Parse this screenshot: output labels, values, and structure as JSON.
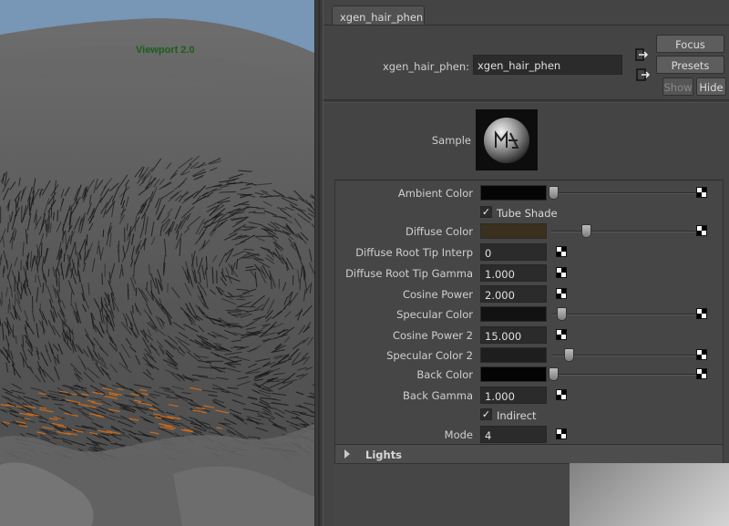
{
  "viewport": {
    "label": "Viewport 2.0"
  },
  "editor": {
    "tab_label": "xgen_hair_phen",
    "node_label": "xgen_hair_phen:",
    "node_name": "xgen_hair_phen",
    "buttons": {
      "focus": "Focus",
      "presets": "Presets",
      "show": "Show",
      "hide": "Hide"
    },
    "icons": {
      "load_input": "input-connection-icon",
      "load_output": "output-connection-icon",
      "sample_logo": "maya-logo-icon"
    },
    "sample_label": "Sample",
    "attributes": [
      {
        "label": "Ambient Color",
        "kind": "color",
        "color": "#050505",
        "slider": 0.01
      },
      {
        "label": "Tube Shade",
        "kind": "checkbox",
        "checked": true
      },
      {
        "label": "Diffuse Color",
        "kind": "color",
        "color": "#3b301d",
        "slider": 0.24
      },
      {
        "label": "Diffuse Root Tip Interp",
        "kind": "number",
        "value": "0"
      },
      {
        "label": "Diffuse Root Tip Gamma",
        "kind": "number",
        "value": "1.000"
      },
      {
        "label": "Cosine Power",
        "kind": "number",
        "value": "2.000"
      },
      {
        "label": "Specular Color",
        "kind": "color",
        "color": "#121212",
        "slider": 0.07
      },
      {
        "label": "Cosine Power 2",
        "kind": "number",
        "value": "15.000"
      },
      {
        "label": "Specular Color 2",
        "kind": "color",
        "color": "#1e1e1e",
        "slider": 0.12
      },
      {
        "label": "Back Color",
        "kind": "color",
        "color": "#040404",
        "slider": 0.01
      },
      {
        "label": "Back Gamma",
        "kind": "number",
        "value": "1.000"
      },
      {
        "label": "Indirect",
        "kind": "checkbox",
        "checked": true
      },
      {
        "label": "Mode",
        "kind": "number",
        "value": "4"
      }
    ],
    "lights_section": "Lights"
  }
}
